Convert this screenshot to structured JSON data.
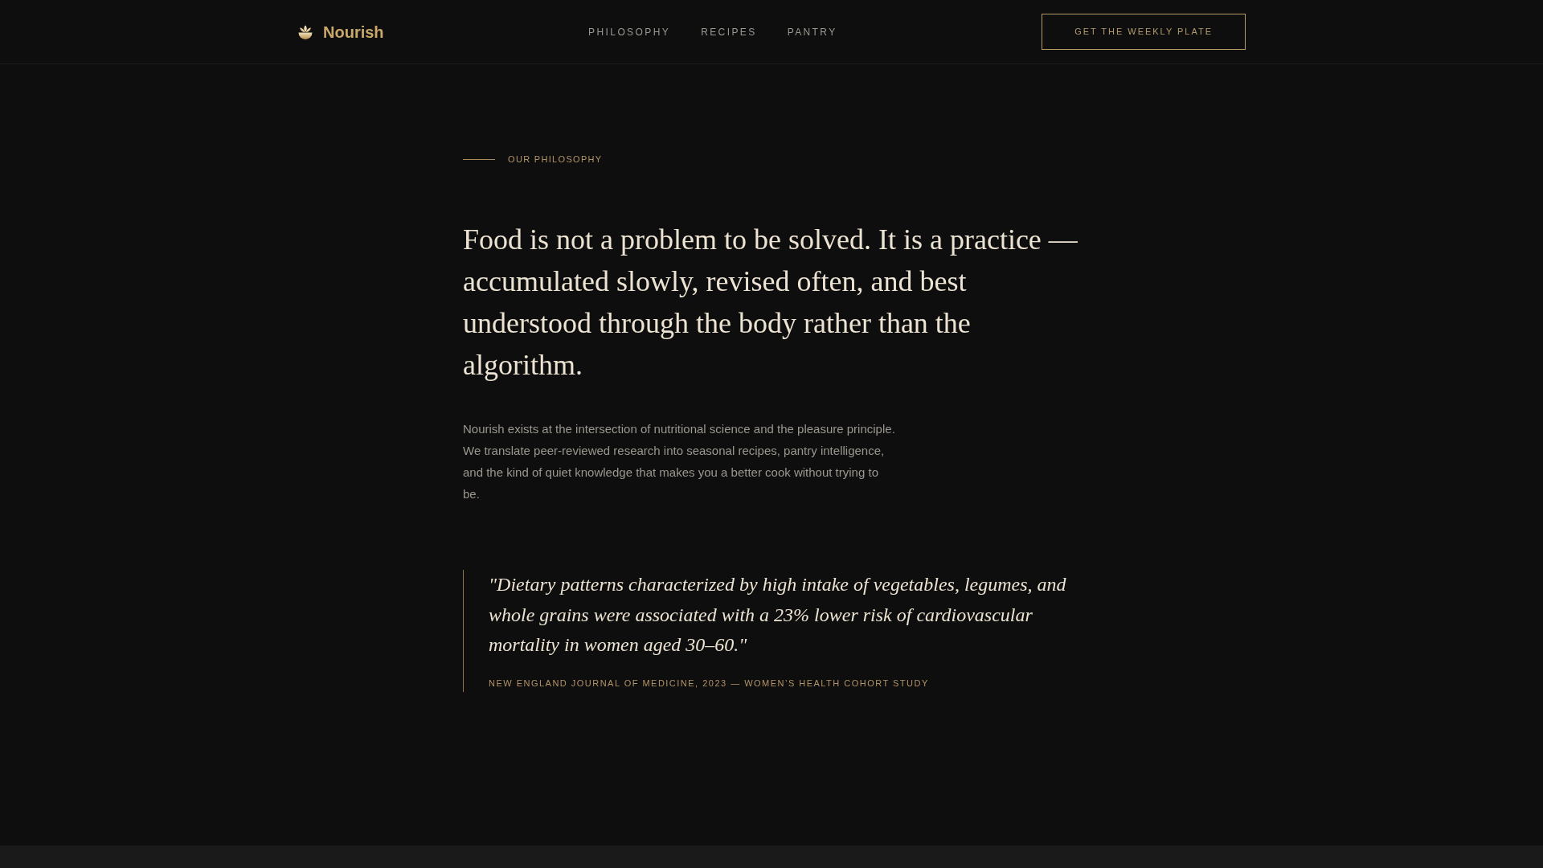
{
  "header": {
    "logo": "Nourish",
    "nav": [
      "PHILOSOPHY",
      "RECIPES",
      "PANTRY"
    ],
    "cta": "GET THE WEEKLY PLATE"
  },
  "philosophy": {
    "eyebrow": "OUR PHILOSOPHY",
    "headline": "Food is not a problem to be solved. It is a practice — accumulated slowly, revised often, and best understood through the body rather than the algorithm.",
    "body": "Nourish exists at the intersection of nutritional science and the pleasure principle. We translate peer-reviewed research into seasonal recipes, pantry intelligence, and the kind of quiet knowledge that makes you a better cook without trying to be.",
    "quote": {
      "text": "\"Dietary patterns characterized by high intake of vegetables, legumes, and whole grains were associated with a 23% lower risk of cardiovascular mortality in women aged 30–60.\"",
      "citation": "NEW ENGLAND JOURNAL OF MEDICINE, 2023 — WOMEN’S HEALTH COHORT STUDY"
    }
  }
}
